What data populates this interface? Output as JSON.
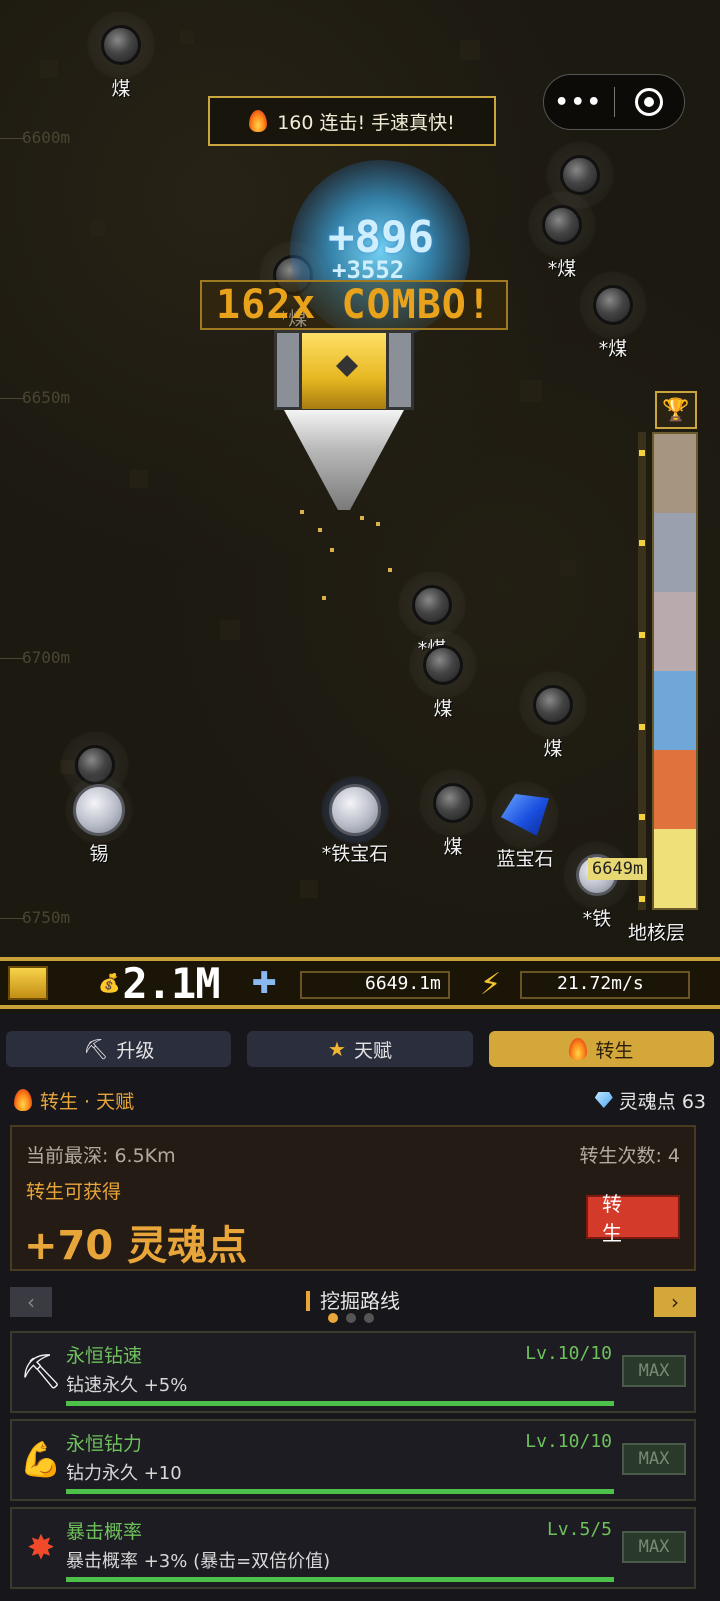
{
  "game": {
    "depth_markers": [
      "6600m",
      "6650m",
      "6700m",
      "6750m"
    ],
    "combo_banner_text": "160 连击! 手速真快!",
    "combo_big_text": "162x COMBO!",
    "damage_big": "+896",
    "damage_small": "+3552",
    "menu_dots": "•••",
    "ores": [
      {
        "label": "煤"
      },
      {
        "label": "煤"
      },
      {
        "label": "*煤"
      },
      {
        "label": "*煤"
      },
      {
        "label": "*煤"
      },
      {
        "label": "*煤"
      },
      {
        "label": "煤"
      },
      {
        "label": "煤"
      },
      {
        "label": "煤"
      },
      {
        "label": "锡"
      },
      {
        "label": "*铁宝石"
      },
      {
        "label": "蓝宝石"
      },
      {
        "label": "*铁"
      }
    ],
    "gauge": {
      "colors": [
        "#a69580",
        "#9aa0ad",
        "#b9aaae",
        "#6fa8d8",
        "#e0723e",
        "#f0e07a"
      ],
      "depth_tag": "6649m",
      "bottom_label": "地核层"
    }
  },
  "status": {
    "money": "2.1M",
    "depth": "6649.1m",
    "speed": "21.72m/s"
  },
  "tabs": [
    {
      "label": "升级",
      "icon": "pickaxe-icon",
      "active": false
    },
    {
      "label": "天赋",
      "icon": "star-icon",
      "active": false
    },
    {
      "label": "转生",
      "icon": "flame-icon",
      "active": true
    }
  ],
  "sub_header": {
    "title": "转生 · 天赋",
    "soul_points": "灵魂点 63"
  },
  "rebirth": {
    "current_depth": "当前最深: 6.5Km",
    "rebirth_count": "转生次数: 4",
    "can_gain": "转生可获得",
    "gain": "+70 灵魂点",
    "button": "转 生"
  },
  "route": {
    "title": "挖掘路线",
    "prev": "‹",
    "next": "›",
    "page": 1,
    "pages": 3
  },
  "talents": [
    {
      "name": "永恒钻速",
      "desc": "钻速永久 +5%",
      "level": "Lv.10/10",
      "progress": 1.0,
      "max": "MAX",
      "icon": "pickaxe-icon"
    },
    {
      "name": "永恒钻力",
      "desc": "钻力永久 +10",
      "level": "Lv.10/10",
      "progress": 1.0,
      "max": "MAX",
      "icon": "muscle-icon"
    },
    {
      "name": "暴击概率",
      "desc": "暴击概率 +3% (暴击=双倍价值)",
      "level": "Lv.5/5",
      "progress": 1.0,
      "max": "MAX",
      "icon": "burst-icon"
    }
  ]
}
